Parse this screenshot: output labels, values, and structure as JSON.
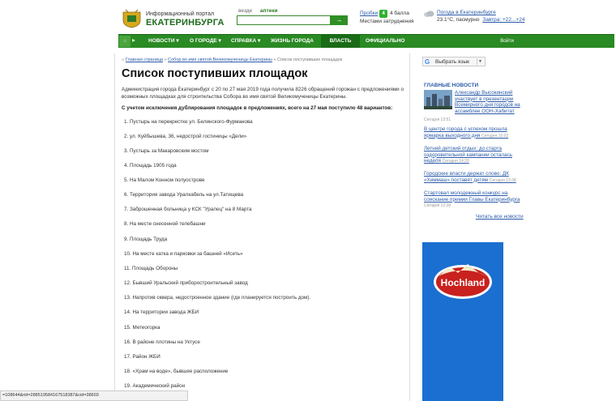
{
  "header": {
    "logo_top": "Информационный портал",
    "logo_main": "ЕКАТЕРИНБУРГА",
    "search_tabs": [
      "везде",
      "аптеки"
    ],
    "search_button_icon": "arrow-right-icon",
    "traffic_label": "Пробки",
    "traffic_badge": "4",
    "traffic_score": "4 балла",
    "traffic_sub": "Местами затруднения",
    "weather_title": "Погода в Екатеринбурге",
    "weather_now": "23.1°С, пасмурно",
    "weather_tomorrow": "Завтра: +22...+24"
  },
  "nav": {
    "home_icon": "home-icon",
    "arrow_icon": "chevron-right-icon",
    "items": [
      "НОВОСТИ ▾",
      "О ГОРОДЕ ▾",
      "СПРАВКА ▾",
      "ЖИЗНЬ ГОРОДА",
      "ВЛАСТЬ",
      "ОФИЦИАЛЬНО"
    ],
    "login": "Войти"
  },
  "breadcrumb": {
    "home": "Главная страница",
    "sep": "»",
    "parent": "Собор во имя святой Великомученицы Екатерины",
    "current": "Список поступивших площадок"
  },
  "page": {
    "title": "Список поступивших площадок",
    "intro": "Администрация города Екатеринбург с 20 по 27 мая 2019 года получила 8226 обращений горожан с предложениями о возможных площадках для строительства Собора во имя святой Великомученицы Екатерины.",
    "summary": "С учетом исключения дублирования площадок в предложениях, всего на 27 мая поступило 48 вариантов:",
    "items": [
      "1. Пустырь на перекрестке ул. Белинского-Фурманова",
      "2. ул. Куйбышева, 36, недострой гостиницы «Дели»",
      "3. Пустырь за Макаровским мостом",
      "4. Площадь 1905 года",
      "5. На Малом Конном полуострове",
      "6. Территория завода Уралкабель на ул.Татищева",
      "7. Заброшенная больница у КСК \"Уралец\" на 8 Марта",
      "8. На месте снесенной телебашни",
      "9. Площадь Труда",
      "10. На месте катка и парковки за башней «Исеть»",
      "11. Площадь Обороны",
      "12. Бывший Уральский приборостроительный завод",
      "13. Напротив сквера, недостроенное здание (где планируется построить дом).",
      "14. На территории завода ЖБИ",
      "15. Метеогорка",
      "16. В районе плотины на Уктусе",
      "17. Район ЖБИ",
      "18. «Храм на воде», бывшее расположение",
      "19. Академический район"
    ]
  },
  "sidebar": {
    "translate_label": "Выбрать язык",
    "translate_caret": "▼",
    "news_heading": "ГЛАВНЫЕ НОВОСТИ",
    "news": [
      {
        "text": "Александр Высокинский участвует в презентации Всемирного дня городов на ассамблее ООН-Хабитат",
        "time": "Сегодня 13:51"
      },
      {
        "text": "В центре города с успехом прошла ярмарка выходного дня",
        "time": "Сегодня 15:02"
      },
      {
        "text": "Летний детский отдых: до старта оздоровительной кампании осталась неделя",
        "time": "Сегодня 14:20"
      },
      {
        "text": "Городские власти держат слово: ДК «Химмаш» поставят детям",
        "time": "Сегодня 13:38"
      },
      {
        "text": "Стартовал молодежный конкурс на соискание премии Главы Екатеринбурга",
        "time": "Сегодня 12:28"
      }
    ],
    "more_news": "Читать все новости",
    "ad_brand": "Hochland"
  },
  "statusbar": {
    "text": "=108644&rid=288519584167518387&cid=38603"
  },
  "colors": {
    "nav_green": "#2a8a24",
    "link_blue": "#2a5aa8",
    "ad_blue": "#1b6fd0"
  }
}
